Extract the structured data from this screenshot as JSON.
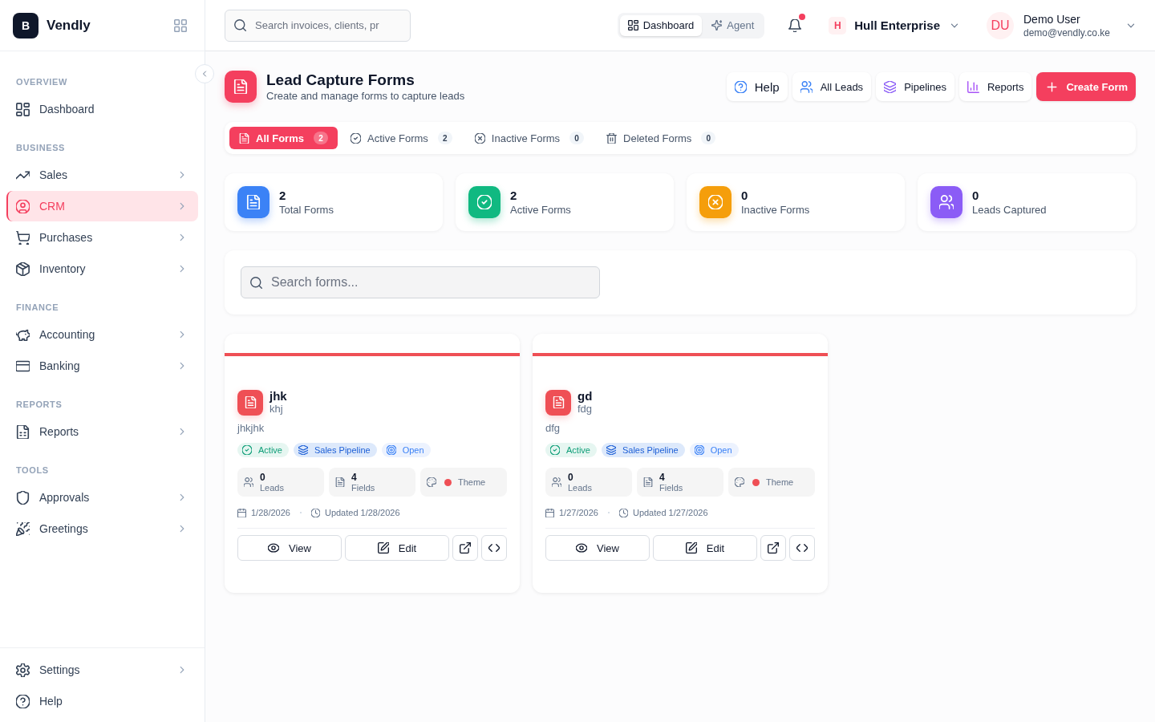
{
  "sidebar": {
    "brand": {
      "letter": "B",
      "name": "Vendly"
    },
    "sections": [
      {
        "heading": "OVERVIEW",
        "items": [
          {
            "label": "Dashboard",
            "has_submenu": false,
            "selected": false
          }
        ]
      },
      {
        "heading": "BUSINESS",
        "items": [
          {
            "label": "Sales",
            "has_submenu": true,
            "selected": false
          },
          {
            "label": "CRM",
            "has_submenu": true,
            "selected": true
          },
          {
            "label": "Purchases",
            "has_submenu": true,
            "selected": false
          },
          {
            "label": "Inventory",
            "has_submenu": true,
            "selected": false
          }
        ]
      },
      {
        "heading": "FINANCE",
        "items": [
          {
            "label": "Accounting",
            "has_submenu": true,
            "selected": false
          },
          {
            "label": "Banking",
            "has_submenu": true,
            "selected": false
          }
        ]
      },
      {
        "heading": "REPORTS",
        "items": [
          {
            "label": "Reports",
            "has_submenu": true,
            "selected": false
          }
        ]
      },
      {
        "heading": "TOOLS",
        "items": [
          {
            "label": "Approvals",
            "has_submenu": true,
            "selected": false
          },
          {
            "label": "Greetings",
            "has_submenu": true,
            "selected": false
          }
        ]
      }
    ],
    "footer_items": [
      {
        "label": "Settings",
        "has_submenu": true,
        "selected": false
      },
      {
        "label": "Help",
        "has_submenu": false,
        "selected": false
      }
    ]
  },
  "topbar": {
    "search": {
      "placeholder": "Search invoices, clients, pr"
    },
    "modes": [
      {
        "label": "Dashboard",
        "selected": true
      },
      {
        "label": "Agent",
        "selected": false
      }
    ],
    "notifications": {
      "unread": true
    },
    "company": {
      "initial": "H",
      "name": "Hull Enterprise"
    },
    "user": {
      "initials": "DU",
      "name": "Demo User",
      "email": "demo@vendly.co.ke"
    }
  },
  "page_header": {
    "title": "Lead Capture Forms",
    "subtitle": "Create and manage forms to capture leads",
    "actions": [
      {
        "label": "Help",
        "kind": "help"
      },
      {
        "label": "All Leads",
        "kind": "secondary"
      },
      {
        "label": "Pipelines",
        "kind": "secondary"
      },
      {
        "label": "Reports",
        "kind": "secondary"
      },
      {
        "label": "Create Form",
        "kind": "primary"
      }
    ]
  },
  "tabs": [
    {
      "label": "All Forms",
      "count": "2",
      "selected": true
    },
    {
      "label": "Active Forms",
      "count": "2",
      "selected": false
    },
    {
      "label": "Inactive Forms",
      "count": "0",
      "selected": false
    },
    {
      "label": "Deleted Forms",
      "count": "0",
      "selected": false
    }
  ],
  "stats": [
    {
      "value": "2",
      "label": "Total Forms",
      "color": "#3b82f6"
    },
    {
      "value": "2",
      "label": "Active Forms",
      "color": "#10b981"
    },
    {
      "value": "0",
      "label": "Inactive Forms",
      "color": "#f59e0b"
    },
    {
      "value": "0",
      "label": "Leads Captured",
      "color": "#8b5cf6"
    }
  ],
  "forms_search": {
    "placeholder": "Search forms..."
  },
  "forms": [
    {
      "name": "jhk",
      "subtitle": "khj",
      "description": "jhkjhk",
      "badges": [
        {
          "label": "Active",
          "kind": "status"
        },
        {
          "label": "Sales Pipeline",
          "kind": "pipeline"
        },
        {
          "label": "Open",
          "kind": "access"
        }
      ],
      "leads": {
        "value": "0",
        "label": "Leads"
      },
      "fields": {
        "value": "4",
        "label": "Fields"
      },
      "theme": {
        "label": "Theme",
        "color": "#ef4f55"
      },
      "created": "1/28/2026",
      "updated": "Updated 1/28/2026",
      "actions": [
        {
          "label": "View"
        },
        {
          "label": "Edit"
        }
      ]
    },
    {
      "name": "gd",
      "subtitle": "fdg",
      "description": "dfg",
      "badges": [
        {
          "label": "Active",
          "kind": "status"
        },
        {
          "label": "Sales Pipeline",
          "kind": "pipeline"
        },
        {
          "label": "Open",
          "kind": "access"
        }
      ],
      "leads": {
        "value": "0",
        "label": "Leads"
      },
      "fields": {
        "value": "4",
        "label": "Fields"
      },
      "theme": {
        "label": "Theme",
        "color": "#ef4f55"
      },
      "created": "1/27/2026",
      "updated": "Updated 1/27/2026",
      "actions": [
        {
          "label": "View"
        },
        {
          "label": "Edit"
        }
      ]
    }
  ]
}
